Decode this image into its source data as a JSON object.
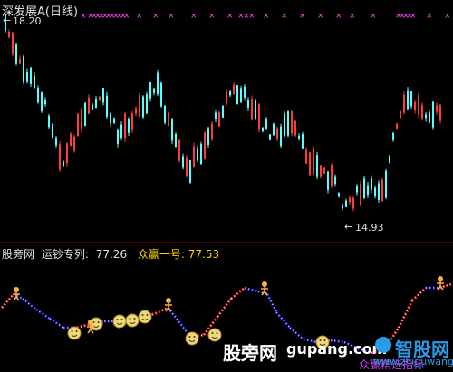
{
  "header": {
    "title": "深发展A(日线)",
    "high_label": "18.20",
    "low_label": "14.93",
    "arrow": "←"
  },
  "indicator": {
    "name": "股旁网",
    "line1_label": "运钞专列:",
    "line1_value": "77.26",
    "line2_label": "众赢一号:",
    "line2_value": "77.53"
  },
  "watermarks": {
    "center": "股旁网",
    "domain": "gupang.com",
    "logo": "智股网",
    "logo_url": "www.zhiguwang.cn",
    "bottom_purple": "众赢精选指标"
  },
  "colors": {
    "background": "#000000",
    "up_candle": "#ff3b3b",
    "down_candle": "#54ffff",
    "signal_marks": "#ff44ff",
    "indicator_red": "#ff2a2a",
    "indicator_blue": "#2a2aff",
    "indicator_white": "#ffffff",
    "divider": "#a00000"
  }
}
